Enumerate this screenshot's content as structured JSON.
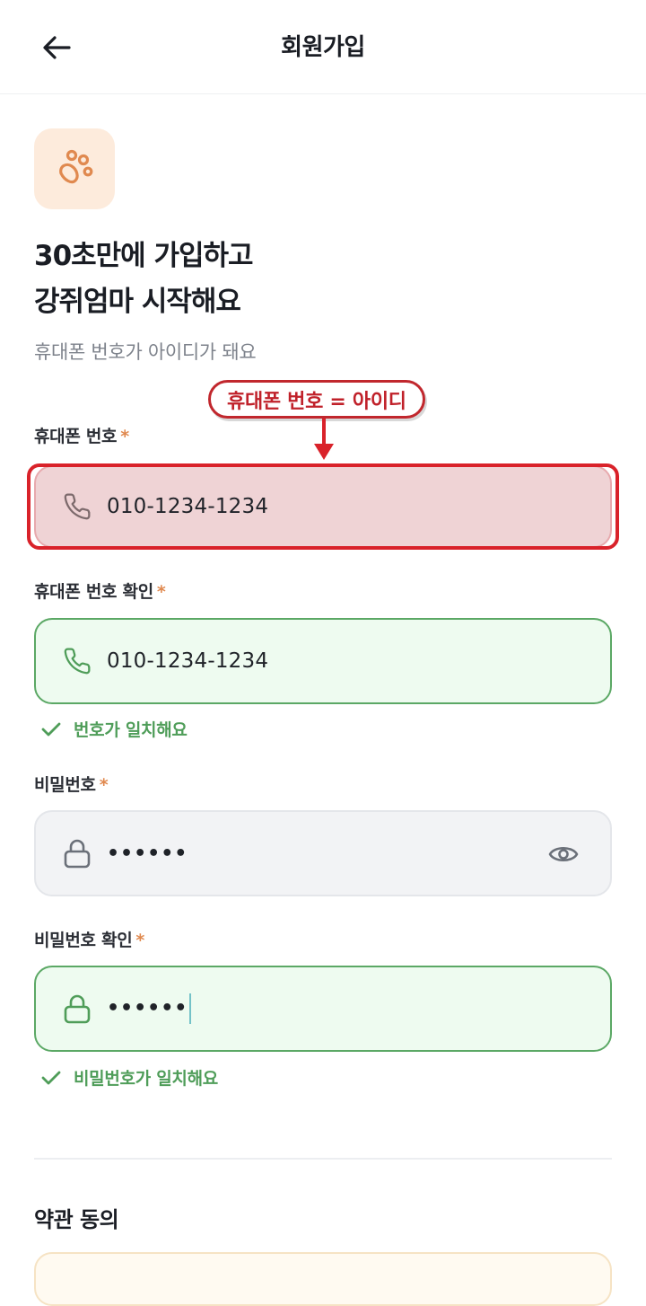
{
  "header": {
    "title": "회원가입"
  },
  "hero": {
    "headline_line1": "30초만에 가입하고",
    "headline_line2": "강쥐엄마 시작해요",
    "subtitle": "휴대폰 번호가 아이디가 돼요"
  },
  "form": {
    "phone": {
      "label": "휴대폰 번호",
      "required_mark": "*",
      "value": "010-1234-1234"
    },
    "phone_confirm": {
      "label": "휴대폰 번호 확인",
      "required_mark": "*",
      "value": "010-1234-1234",
      "status": "번호가 일치해요"
    },
    "password": {
      "label": "비밀번호",
      "required_mark": "*",
      "masked_value": "••••••"
    },
    "password_confirm": {
      "label": "비밀번호 확인",
      "required_mark": "*",
      "masked_value": "••••••",
      "status": "비밀번호가 일치해요"
    }
  },
  "annotation": {
    "text": "휴대폰 번호 = 아이디"
  },
  "terms": {
    "title": "약관 동의"
  },
  "icons": {
    "back": "arrow-left-icon",
    "logo": "paw-icon",
    "phone": "phone-icon",
    "lock": "lock-icon",
    "eye": "eye-icon",
    "check": "check-icon"
  },
  "colors": {
    "accent_orange": "#e0894f",
    "success_green": "#4f9d59",
    "annotation_red": "#d9222a"
  }
}
